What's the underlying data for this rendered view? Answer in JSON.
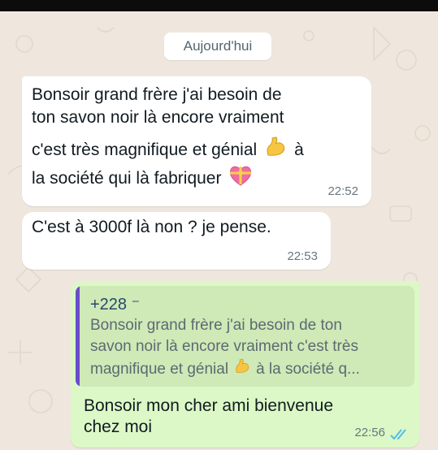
{
  "date_chip": "Aujourd'hui",
  "messages": [
    {
      "lines": [
        "Bonsoir grand frère j'ai besoin de",
        "ton savon noir là encore vraiment",
        "c'est très magnifique et génial",
        "à",
        "la société qui là fabriquer"
      ],
      "time": "22:52"
    },
    {
      "lines": [
        "C'est à 3000f là non ? je pense."
      ],
      "time": "22:53"
    }
  ],
  "reply": {
    "quoted_sender": "+228 ⁻",
    "quoted_lines": [
      "Bonsoir grand frère j'ai besoin de ton",
      "savon noir là encore vraiment c'est très",
      "magnifique et génial",
      "à la société q..."
    ],
    "lines": [
      "Bonsoir mon cher ami bienvenue",
      "chez moi"
    ],
    "time": "22:56",
    "status_icon": "double-check-read"
  },
  "colors": {
    "wallpaper": "#efe7dd",
    "incoming": "#ffffff",
    "outgoing": "#dcf8c6",
    "quote_bar": "#6b4bcc",
    "read_ticks": "#53bdeb"
  },
  "emoji": [
    "flexed-biceps-icon",
    "heart-with-ribbon-icon"
  ]
}
